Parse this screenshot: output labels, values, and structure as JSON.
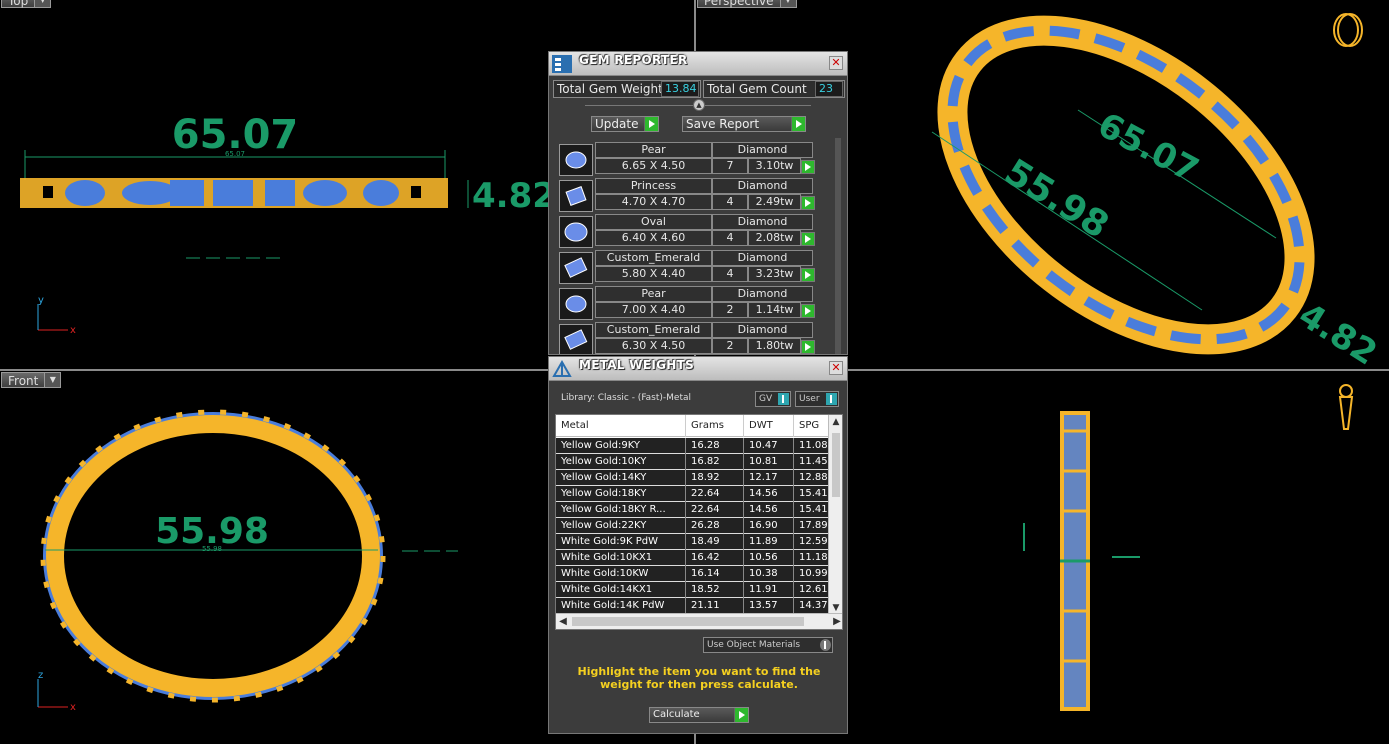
{
  "viewports": {
    "top": {
      "label": "Top"
    },
    "perspective": {
      "label": "Perspective"
    },
    "front": {
      "label": "Front"
    },
    "right": {
      "label": ""
    }
  },
  "dimensions": {
    "width": "65.07",
    "width_small": "65.07",
    "height": "4.82",
    "height_small": "4.82",
    "inner": "55.98",
    "inner_small": "55.98"
  },
  "gem_reporter": {
    "title": "GEM REPORTER",
    "total_weight_label": "Total Gem Weight",
    "total_weight_value": "13.84",
    "total_count_label": "Total Gem Count",
    "total_count_value": "23",
    "update_label": "Update",
    "save_label": "Save Report",
    "gems": [
      {
        "shape": "Pear",
        "size": "6.65 X 4.50",
        "material": "Diamond",
        "count": "7",
        "weight": "3.10tw"
      },
      {
        "shape": "Princess",
        "size": "4.70 X 4.70",
        "material": "Diamond",
        "count": "4",
        "weight": "2.49tw"
      },
      {
        "shape": "Oval",
        "size": "6.40 X 4.60",
        "material": "Diamond",
        "count": "4",
        "weight": "2.08tw"
      },
      {
        "shape": "Custom_Emerald",
        "size": "5.80 X 4.40",
        "material": "Diamond",
        "count": "4",
        "weight": "3.23tw"
      },
      {
        "shape": "Pear",
        "size": "7.00 X 4.40",
        "material": "Diamond",
        "count": "2",
        "weight": "1.14tw"
      },
      {
        "shape": "Custom_Emerald",
        "size": "6.30 X 4.50",
        "material": "Diamond",
        "count": "2",
        "weight": "1.80tw"
      }
    ]
  },
  "metal_weights": {
    "title": "METAL WEIGHTS",
    "library": "Library: Classic - (Fast)-Metal",
    "gv_label": "GV",
    "user_label": "User",
    "columns": [
      "Metal",
      "Grams",
      "DWT",
      "SPG"
    ],
    "rows": [
      [
        "Yellow Gold:9KY",
        "16.28",
        "10.47",
        "11.08"
      ],
      [
        "Yellow Gold:10KY",
        "16.82",
        "10.81",
        "11.45"
      ],
      [
        "Yellow Gold:14KY",
        "18.92",
        "12.17",
        "12.88"
      ],
      [
        "Yellow Gold:18KY",
        "22.64",
        "14.56",
        "15.41"
      ],
      [
        "Yellow Gold:18KY R...",
        "22.64",
        "14.56",
        "15.41"
      ],
      [
        "Yellow Gold:22KY",
        "26.28",
        "16.90",
        "17.89"
      ],
      [
        "White Gold:9K PdW",
        "18.49",
        "11.89",
        "12.59"
      ],
      [
        "White Gold:10KX1",
        "16.42",
        "10.56",
        "11.18"
      ],
      [
        "White Gold:10KW",
        "16.14",
        "10.38",
        "10.99"
      ],
      [
        "White Gold:14KX1",
        "18.52",
        "11.91",
        "12.61"
      ],
      [
        "White Gold:14K PdW",
        "21.11",
        "13.57",
        "14.37"
      ]
    ],
    "use_object_materials": "Use Object Materials",
    "hint": "Highlight the item you want to find the weight for then press calculate.",
    "calculate_label": "Calculate"
  },
  "colors": {
    "gold": "#f5b52a",
    "gem": "#4a7ddb",
    "dim": "#1a9a68",
    "accent": "#2eb82e"
  }
}
